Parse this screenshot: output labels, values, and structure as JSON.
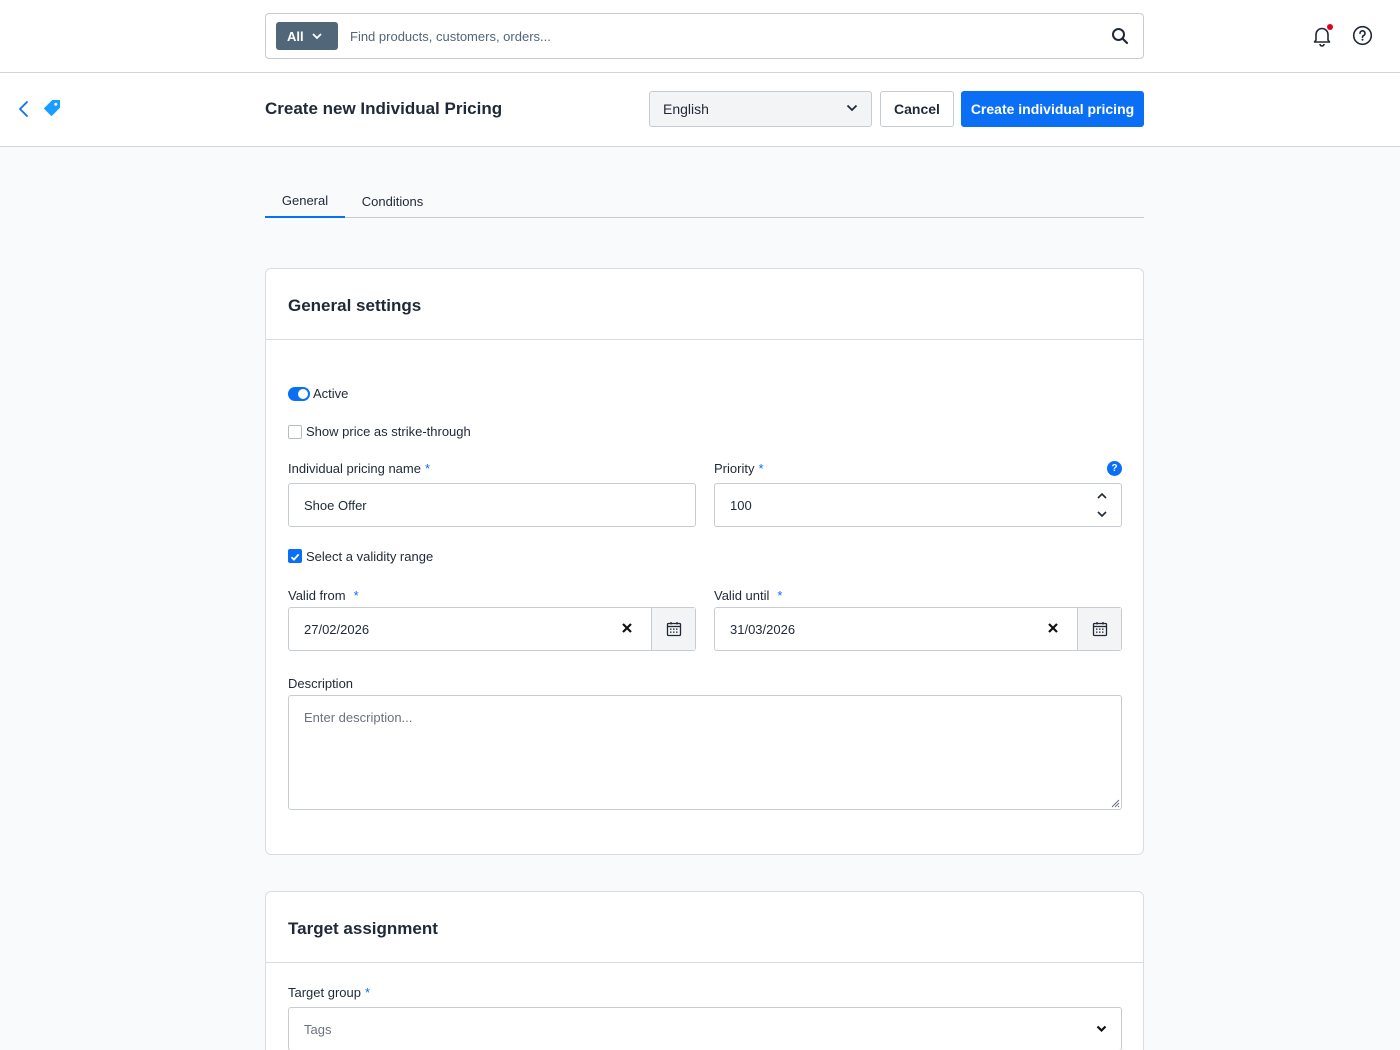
{
  "search": {
    "scope_label": "All",
    "placeholder": "Find products, customers, orders..."
  },
  "header": {
    "title": "Create new Individual Pricing",
    "language": "English",
    "cancel_label": "Cancel",
    "create_label": "Create individual pricing"
  },
  "tabs": [
    {
      "label": "General",
      "active": true
    },
    {
      "label": "Conditions",
      "active": false
    }
  ],
  "general_settings": {
    "title": "General settings",
    "active_label": "Active",
    "active": true,
    "strike_through_label": "Show price as strike-through",
    "strike_through": false,
    "name_label": "Individual pricing name",
    "name_value": "Shoe Offer",
    "priority_label": "Priority",
    "priority_value": "100",
    "validity_label": "Select a validity range",
    "validity_checked": true,
    "valid_from_label": "Valid from",
    "valid_from_value": "27/02/2026",
    "valid_until_label": "Valid until",
    "valid_until_value": "31/03/2026",
    "description_label": "Description",
    "description_placeholder": "Enter description...",
    "required_mark": "*",
    "help_mark": "?"
  },
  "target_assignment": {
    "title": "Target assignment",
    "target_group_label": "Target group",
    "target_group_placeholder": "Tags"
  },
  "colors": {
    "primary": "#0b6ff5",
    "notification_dot": "#e3001b",
    "scope_bg": "#52667a"
  }
}
